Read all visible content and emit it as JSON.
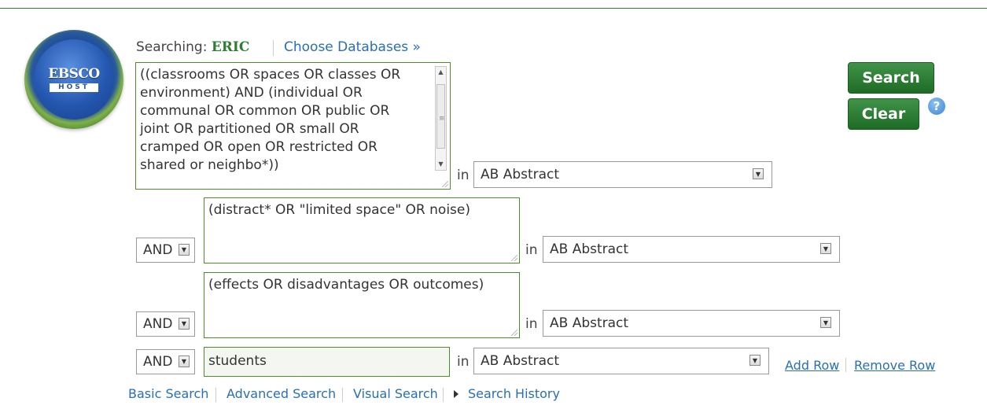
{
  "header": {
    "searching_label": "Searching:",
    "database": "ERIC",
    "choose_databases": "Choose Databases »"
  },
  "logo": {
    "word": "EBSCO",
    "sub": "HOST"
  },
  "rows": [
    {
      "query": "((classrooms OR spaces OR classes OR environment) AND (individual OR communal OR common OR public OR joint OR partitioned OR small OR cramped OR open OR restricted OR shared or neighbo*))",
      "in_label": "in",
      "field": "AB Abstract"
    },
    {
      "operator": "AND",
      "query": "(distract* OR \"limited space\" OR noise)",
      "in_label": "in",
      "field": "AB Abstract"
    },
    {
      "operator": "AND",
      "query": "(effects OR disadvantages OR outcomes)",
      "in_label": "in",
      "field": "AB Abstract"
    },
    {
      "operator": "AND",
      "query": "students",
      "in_label": "in",
      "field": "AB Abstract"
    }
  ],
  "buttons": {
    "search": "Search",
    "clear": "Clear",
    "help": "?"
  },
  "row_actions": {
    "add_row": "Add Row",
    "remove_row": "Remove Row"
  },
  "bottom_nav": {
    "basic_search": "Basic Search",
    "advanced_search": "Advanced Search",
    "visual_search": "Visual Search",
    "search_history": "Search History"
  },
  "colors": {
    "accent_green": "#2e7d32",
    "link_blue": "#2a6fb0"
  },
  "icons": [
    "help-icon",
    "dropdown-arrow-icon",
    "resize-grip-icon",
    "triangle-right-icon",
    "ebsco-host-logo"
  ]
}
